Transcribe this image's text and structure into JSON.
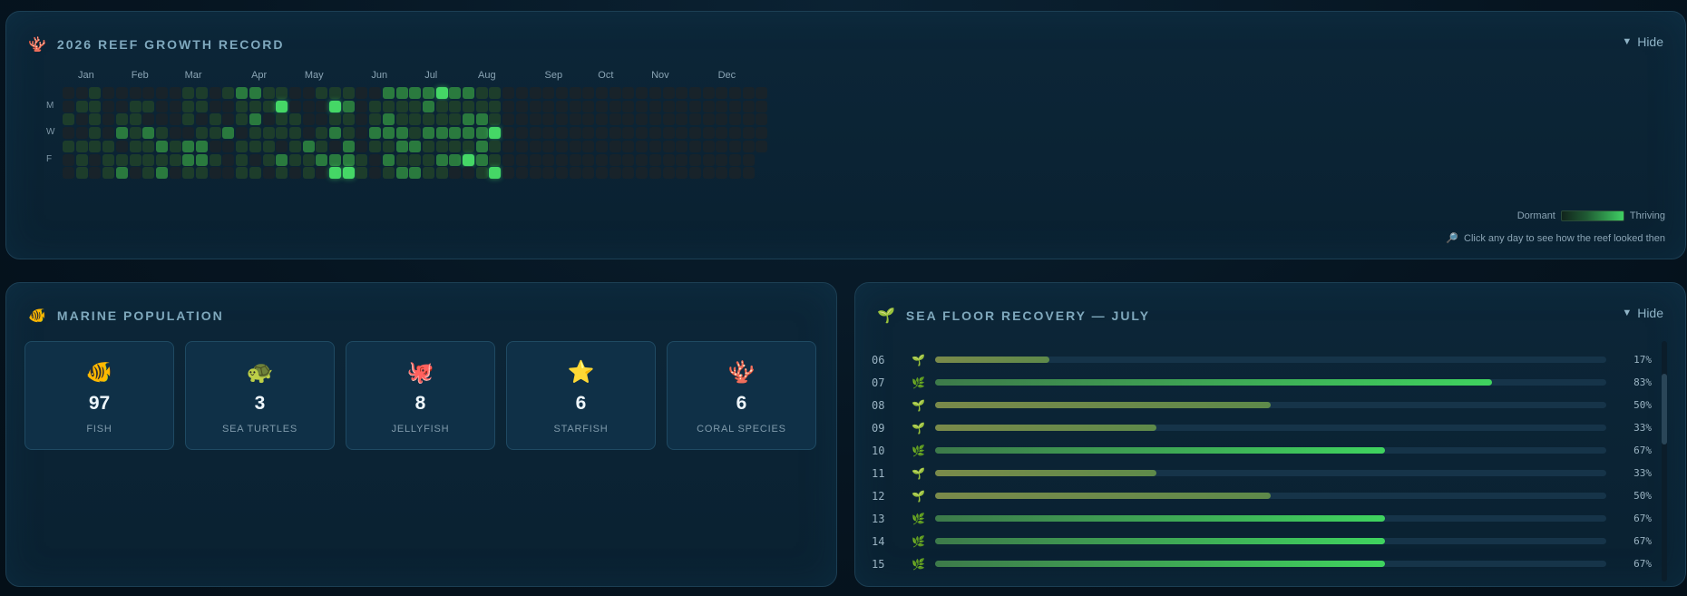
{
  "reef": {
    "title": "2026 REEF GROWTH RECORD",
    "icon": "coral-icon",
    "hide_label": "Hide",
    "months": [
      "Jan",
      "Feb",
      "Mar",
      "Apr",
      "May",
      "Jun",
      "Jul",
      "Aug",
      "Sep",
      "Oct",
      "Nov",
      "Dec"
    ],
    "day_labels": [
      "M",
      "W",
      "F"
    ],
    "legend_low": "Dormant",
    "legend_high": "Thriving",
    "hint": "Click any day to see how the reef looked then",
    "levels_by_week": [
      [
        0,
        0,
        1,
        0,
        1,
        0,
        0
      ],
      [
        0,
        1,
        0,
        0,
        1,
        1,
        1
      ],
      [
        1,
        1,
        1,
        1,
        1,
        0,
        0
      ],
      [
        0,
        0,
        0,
        0,
        1,
        1,
        1
      ],
      [
        0,
        0,
        1,
        2,
        0,
        1,
        2
      ],
      [
        0,
        1,
        1,
        1,
        1,
        1,
        0
      ],
      [
        0,
        1,
        0,
        2,
        1,
        1,
        1
      ],
      [
        0,
        0,
        0,
        1,
        2,
        1,
        2
      ],
      [
        0,
        0,
        0,
        0,
        1,
        1,
        0
      ],
      [
        1,
        1,
        1,
        0,
        2,
        2,
        1
      ],
      [
        1,
        1,
        0,
        1,
        2,
        2,
        1
      ],
      [
        0,
        0,
        1,
        1,
        0,
        1,
        0
      ],
      [
        1,
        0,
        0,
        2,
        0,
        0,
        0
      ],
      [
        2,
        1,
        1,
        0,
        1,
        1,
        1
      ],
      [
        2,
        1,
        2,
        1,
        1,
        0,
        1
      ],
      [
        1,
        1,
        0,
        1,
        1,
        1,
        0
      ],
      [
        1,
        3,
        1,
        1,
        0,
        2,
        1
      ],
      [
        0,
        0,
        1,
        1,
        1,
        1,
        0
      ],
      [
        0,
        0,
        0,
        0,
        2,
        1,
        1
      ],
      [
        1,
        0,
        0,
        1,
        1,
        2,
        0
      ],
      [
        1,
        3,
        1,
        2,
        0,
        2,
        3
      ],
      [
        1,
        2,
        1,
        1,
        2,
        2,
        3
      ],
      [
        0,
        0,
        0,
        0,
        0,
        1,
        1
      ],
      [
        0,
        1,
        1,
        2,
        1,
        0,
        0
      ],
      [
        2,
        1,
        2,
        2,
        1,
        2,
        1
      ],
      [
        2,
        1,
        1,
        2,
        2,
        1,
        2
      ],
      [
        2,
        1,
        1,
        1,
        2,
        1,
        2
      ],
      [
        2,
        2,
        1,
        2,
        1,
        1,
        1
      ],
      [
        3,
        1,
        1,
        2,
        1,
        2,
        1
      ],
      [
        2,
        1,
        1,
        2,
        1,
        2,
        0
      ],
      [
        2,
        1,
        2,
        2,
        1,
        3,
        0
      ],
      [
        1,
        1,
        2,
        2,
        2,
        2,
        1
      ],
      [
        1,
        1,
        1,
        3,
        1,
        1,
        3
      ],
      [
        0,
        0,
        0,
        0,
        0,
        0,
        0
      ],
      [
        0,
        0,
        0,
        0,
        0,
        0,
        0
      ],
      [
        0,
        0,
        0,
        0,
        0,
        0,
        0
      ],
      [
        0,
        0,
        0,
        0,
        0,
        0,
        0
      ],
      [
        0,
        0,
        0,
        0,
        0,
        0,
        0
      ],
      [
        0,
        0,
        0,
        0,
        0,
        0,
        0
      ],
      [
        0,
        0,
        0,
        0,
        0,
        0,
        0
      ],
      [
        0,
        0,
        0,
        0,
        0,
        0,
        0
      ],
      [
        0,
        0,
        0,
        0,
        0,
        0,
        0
      ],
      [
        0,
        0,
        0,
        0,
        0,
        0,
        0
      ],
      [
        0,
        0,
        0,
        0,
        0,
        0,
        0
      ],
      [
        0,
        0,
        0,
        0,
        0,
        0,
        0
      ],
      [
        0,
        0,
        0,
        0,
        0,
        0,
        0
      ],
      [
        0,
        0,
        0,
        0,
        0,
        0,
        0
      ],
      [
        0,
        0,
        0,
        0,
        0,
        0,
        0
      ],
      [
        0,
        0,
        0,
        0,
        0,
        0,
        0
      ],
      [
        0,
        0,
        0,
        0,
        0,
        0,
        0
      ],
      [
        0,
        0,
        0,
        0,
        0,
        0,
        0
      ],
      [
        0,
        0,
        0,
        0,
        0,
        0,
        0
      ],
      [
        0,
        0,
        0,
        0,
        0,
        0,
        0
      ]
    ],
    "level_colors": [
      "#18232a",
      "#1d3d2b",
      "#2a7a3e",
      "#45d766"
    ]
  },
  "marine": {
    "title": "MARINE POPULATION",
    "icon": "fish-icon",
    "cards": [
      {
        "icon": "🐠",
        "icon_name": "tropical-fish-icon",
        "count": "97",
        "label": "FISH"
      },
      {
        "icon": "🐢",
        "icon_name": "turtle-icon",
        "count": "3",
        "label": "SEA TURTLES"
      },
      {
        "icon": "🐙",
        "icon_name": "octopus-icon",
        "count": "8",
        "label": "JELLYFISH"
      },
      {
        "icon": "⭐",
        "icon_name": "star-icon",
        "count": "6",
        "label": "STARFISH"
      },
      {
        "icon": "🪸",
        "icon_name": "coral-icon",
        "count": "6",
        "label": "CORAL SPECIES"
      }
    ]
  },
  "floor": {
    "title": "SEA FLOOR RECOVERY — JULY",
    "icon": "seedling-icon",
    "hide_label": "Hide",
    "rows": [
      {
        "day": "06",
        "icon": "🌱",
        "pct": 17,
        "label": "17%"
      },
      {
        "day": "07",
        "icon": "🌿",
        "pct": 83,
        "label": "83%"
      },
      {
        "day": "08",
        "icon": "🌱",
        "pct": 50,
        "label": "50%"
      },
      {
        "day": "09",
        "icon": "🌱",
        "pct": 33,
        "label": "33%"
      },
      {
        "day": "10",
        "icon": "🌿",
        "pct": 67,
        "label": "67%"
      },
      {
        "day": "11",
        "icon": "🌱",
        "pct": 33,
        "label": "33%"
      },
      {
        "day": "12",
        "icon": "🌱",
        "pct": 50,
        "label": "50%"
      },
      {
        "day": "13",
        "icon": "🌿",
        "pct": 67,
        "label": "67%"
      },
      {
        "day": "14",
        "icon": "🌿",
        "pct": 67,
        "label": "67%"
      },
      {
        "day": "15",
        "icon": "🌿",
        "pct": 67,
        "label": "67%"
      }
    ],
    "low_color": "#7a8a4a",
    "high_color": "#3fd35f"
  }
}
